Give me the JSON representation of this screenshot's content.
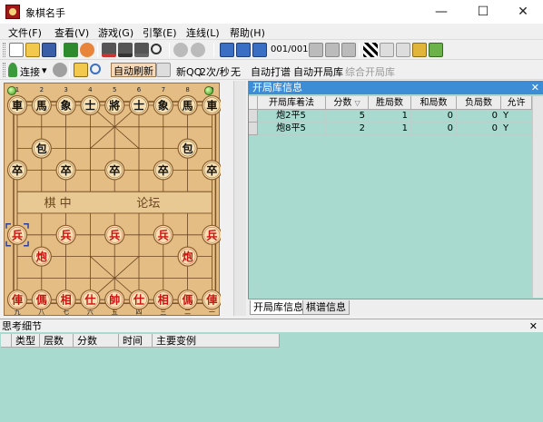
{
  "window": {
    "title": "象棋名手",
    "minimize_glyph": "—",
    "maximize_glyph": "☐",
    "close_glyph": "✕"
  },
  "menu": [
    "文件(F)",
    "查看(V)",
    "游戏(G)",
    "引擎(E)",
    "连线(L)",
    "帮助(H)"
  ],
  "toolbar1": {
    "move_counter": "001/001"
  },
  "toolbar2": {
    "connect_label": "连接",
    "auto_refresh": "自动刷新",
    "new_qq": "新QQ",
    "rate": "2次/秒",
    "none_label": "无",
    "auto_play": "自动打谱",
    "auto_book": "自动开局库",
    "composite_book": "综合开局库"
  },
  "board": {
    "top_numbers": [
      "1",
      "2",
      "3",
      "4",
      "5",
      "6",
      "7",
      "8",
      "9"
    ],
    "bottom_numbers": [
      "九",
      "八",
      "七",
      "六",
      "五",
      "四",
      "三",
      "二",
      "一"
    ],
    "river_left": "棋 中",
    "river_right": "论坛",
    "black_back_row": [
      "車",
      "馬",
      "象",
      "士",
      "將",
      "士",
      "象",
      "馬",
      "車"
    ],
    "black_cannon": "包",
    "black_pawn": "卒",
    "red_back_row": [
      "俥",
      "傌",
      "相",
      "仕",
      "帥",
      "仕",
      "相",
      "傌",
      "俥"
    ],
    "red_cannon": "炮",
    "red_pawn": "兵",
    "colors": {
      "board": "#e4bd84",
      "piece_face": "#f7e1b3",
      "black_text": "#111111",
      "red_text": "#cc1111"
    }
  },
  "opening_panel": {
    "title": "开局库信息",
    "close_glyph": "✕",
    "columns": [
      "开局库着法",
      "分数",
      "胜局数",
      "和局数",
      "负局数",
      "允许"
    ],
    "rows": [
      {
        "move": "炮2平5",
        "score": "5",
        "win": "1",
        "draw": "0",
        "loss": "0",
        "allow": "Y"
      },
      {
        "move": "炮8平5",
        "score": "2",
        "win": "1",
        "draw": "0",
        "loss": "0",
        "allow": "Y"
      }
    ],
    "tabs": [
      "开局库信息",
      "棋谱信息"
    ]
  },
  "think_panel": {
    "title": "思考细节",
    "close_glyph": "✕",
    "columns": [
      "类型",
      "层数",
      "分数",
      "时间",
      "主要变例"
    ]
  }
}
